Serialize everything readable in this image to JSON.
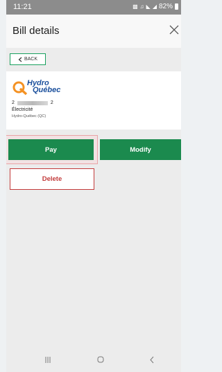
{
  "status_bar": {
    "time": "11:21",
    "icons": [
      "sim-icon",
      "mute-icon",
      "wifi-icon",
      "signal-icon"
    ],
    "battery": "82%"
  },
  "header": {
    "title": "Bill details",
    "close_icon": "close-icon"
  },
  "back_button": {
    "label": "BACK",
    "icon": "chevron-left-icon"
  },
  "bill": {
    "logo": {
      "line1": "Hydro",
      "line2": "Québec"
    },
    "account_prefix": "2",
    "account_suffix": "2",
    "service": "Électricité",
    "provider": "Hydro-Québec (QC)"
  },
  "actions": {
    "pay_label": "Pay",
    "modify_label": "Modify",
    "delete_label": "Delete"
  },
  "nav_bar": {
    "icons": [
      "recent-apps-icon",
      "home-icon",
      "back-icon"
    ]
  },
  "colors": {
    "primary_green": "#1b8a4e",
    "back_border": "#18a05e",
    "delete_red": "#c23a3a",
    "highlight_border": "#e9a3a6",
    "status_bar": "#8c8c8c",
    "logo_blue": "#1a4f9c",
    "logo_orange": "#f49224"
  }
}
